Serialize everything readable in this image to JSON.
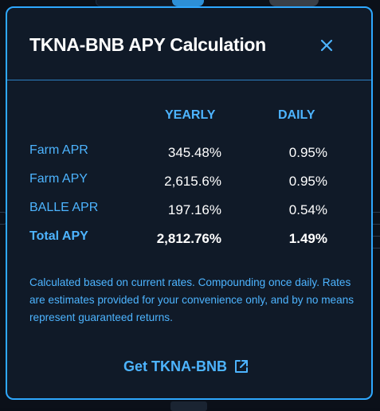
{
  "modal": {
    "title": "TKNA-BNB APY Calculation",
    "close_icon": "close-icon",
    "columns": {
      "yearly": "YEARLY",
      "daily": "DAILY"
    },
    "rows": [
      {
        "label": "Farm APR",
        "yearly": "345.48%",
        "daily": "0.95%"
      },
      {
        "label": "Farm APY",
        "yearly": "2,615.6%",
        "daily": "0.95%"
      },
      {
        "label": "BALLE APR",
        "yearly": "197.16%",
        "daily": "0.54%"
      },
      {
        "label": "Total APY",
        "yearly": "2,812.76%",
        "daily": "1.49%"
      }
    ],
    "note": "Calculated based on current rates. Compounding once daily. Rates are estimates provided for your convenience only, and by no means represent guaranteed returns.",
    "get_link": {
      "label": "Get TKNA-BNB",
      "icon": "external-link-icon"
    }
  },
  "colors": {
    "accent": "#4db4ff",
    "border": "#2ea8ff",
    "panel_bg": "#101a28",
    "text": "#ffffff"
  }
}
